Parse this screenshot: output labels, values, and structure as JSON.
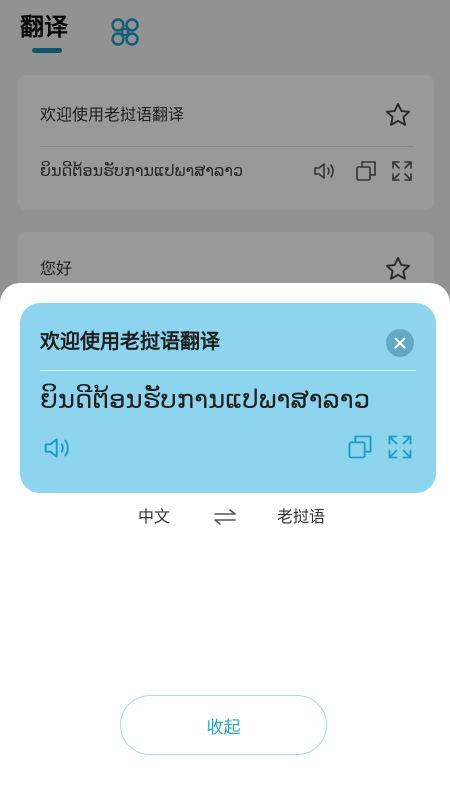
{
  "header": {
    "tab_translate": "翻译",
    "tab_icon": "clover-icon"
  },
  "history": [
    {
      "source": "欢迎使用老挝语翻译",
      "target": "ຍິນດີຕ້ອນຮັບການແປພາສາລາວ",
      "icons": [
        "star-icon",
        "speaker-icon",
        "copy-icon",
        "expand-icon"
      ]
    },
    {
      "source": "您好",
      "icons": [
        "star-icon"
      ]
    }
  ],
  "sheet": {
    "result": {
      "source": "欢迎使用老挝语翻译",
      "target": "ຍິນດີຕ້ອນຮັບການແປພາສາລາວ",
      "icons": [
        "close-icon",
        "speaker-icon",
        "copy-icon",
        "expand-icon"
      ]
    },
    "languages": {
      "from": "中文",
      "to": "老挝语",
      "swap_icon": "swap-icon"
    },
    "collapse_label": "收起"
  },
  "colors": {
    "accent": "#1a9ec9",
    "result_card": "#8dd5ee",
    "close_button": "#64a9c4",
    "collapse_text": "#2aa6c2",
    "collapse_border": "#a9dbe7",
    "overlay": "rgba(0,0,0,0.4)"
  }
}
